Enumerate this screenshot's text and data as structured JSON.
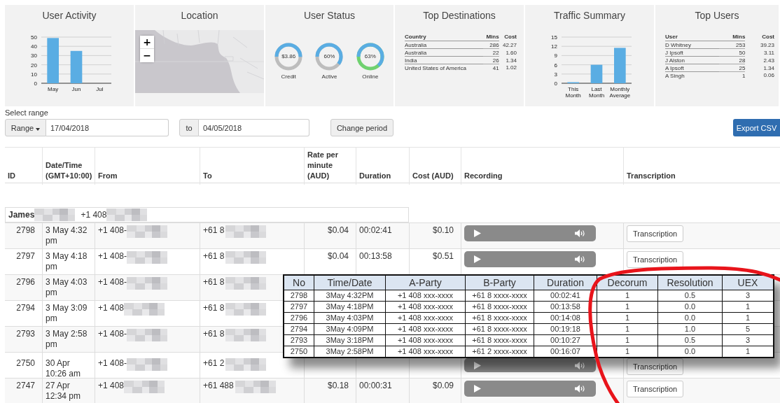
{
  "cards": [
    {
      "kind": "bar_chart",
      "title": "User Activity",
      "chart_data": {
        "type": "bar",
        "categories": [
          "May",
          "Jun",
          "Jul"
        ],
        "values": [
          49,
          35,
          0
        ],
        "grid": true,
        "ylim": [
          0,
          50
        ],
        "yticks": [
          0,
          10,
          20,
          30,
          40,
          50
        ]
      }
    },
    {
      "kind": "map",
      "title": "Location",
      "zoom_in": "+",
      "zoom_out": "−"
    },
    {
      "kind": "donuts",
      "title": "User Status",
      "donuts": [
        {
          "value": "$3.86",
          "label": "Credit",
          "level": 0.5,
          "color": "#bdbdbd"
        },
        {
          "value": "60%",
          "label": "Active",
          "level": 0.6,
          "color": "#bdbdbd"
        },
        {
          "value": "63%",
          "label": "Online",
          "level": 0.63,
          "color": "#6fd16f"
        }
      ]
    },
    {
      "kind": "table",
      "title": "Top Destinations",
      "columns": [
        "Country",
        "Mins",
        "Cost"
      ],
      "rows": [
        [
          "Australia",
          "286",
          "42.27"
        ],
        [
          "Australia",
          "22",
          "1.60"
        ],
        [
          "India",
          "26",
          "1.34"
        ],
        [
          "United States of America",
          "41",
          "1.02"
        ]
      ]
    },
    {
      "kind": "bar_chart",
      "title": "Traffic Summary",
      "chart_data": {
        "type": "bar",
        "categories": [
          "This Month",
          "Last Month",
          "Monthly Average"
        ],
        "values": [
          0.1,
          6,
          11.5
        ],
        "grid": true,
        "ylim": [
          0,
          15
        ],
        "yticks": [
          0,
          3,
          6,
          9,
          12,
          15
        ]
      }
    },
    {
      "kind": "table",
      "title": "Top Users",
      "columns": [
        "User",
        "Mins",
        "Cost"
      ],
      "rows": [
        [
          "D Whitney",
          "253",
          "39.23"
        ],
        [
          "J Ipsoft",
          "50",
          "3.11"
        ],
        [
          "J Alston",
          "28",
          "2.43"
        ],
        [
          "A Ipsoft",
          "25",
          "1.34"
        ],
        [
          "A Singh",
          "1",
          "0.06"
        ]
      ]
    }
  ],
  "range": {
    "label": "Select range",
    "dropdown": "Range",
    "from": "17/04/2018",
    "to_label": "to",
    "to": "04/05/2018",
    "change": "Change period",
    "export": "Export CSV"
  },
  "table": {
    "columns": [
      "ID",
      "Date/Time (GMT+10:00)",
      "From",
      "To",
      "Rate per minute (AUD)",
      "Duration",
      "Cost (AUD)",
      "Recording",
      "Transcription"
    ],
    "group": {
      "name": "James",
      "phone": "+1 408"
    },
    "rows": [
      {
        "id": "2798",
        "datetime": "3 May 4:32 pm",
        "from": "+1 408-",
        "to": "+61 8",
        "rate": "$0.04",
        "duration": "00:02:41",
        "cost": "$0.10",
        "player": true,
        "transcription": "Transcription"
      },
      {
        "id": "2797",
        "datetime": "3 May 4:18 pm",
        "from": "+1 408-",
        "to": "+61 8",
        "rate": "$0.04",
        "duration": "00:13:58",
        "cost": "$0.51",
        "player": true,
        "transcription": "Transcription"
      },
      {
        "id": "2796",
        "datetime": "3 May 4:03 pm",
        "from": "+1 408-",
        "to": "+61 8"
      },
      {
        "id": "2794",
        "datetime": "3 May 3:09 pm",
        "from": "+1 408",
        "to": "+61 8"
      },
      {
        "id": "2793",
        "datetime": "3 May 2:58 pm",
        "from": "+1 408-",
        "to": "+61 8"
      },
      {
        "id": "2750",
        "datetime": "30 Apr 10:26 am",
        "from": "+1 408-",
        "to": "+61 2",
        "player": true,
        "transcription": "Transcription"
      },
      {
        "id": "2747",
        "datetime": "27 Apr 12:34 pm",
        "from": "+1 408",
        "to": "+61 488",
        "rate": "$0.18",
        "duration": "00:00:31",
        "cost": "$0.09",
        "player": true,
        "transcription": "Transcription"
      }
    ]
  },
  "overlay_table": {
    "columns": [
      "No",
      "Time/Date",
      "A-Party",
      "B-Party",
      "Duration",
      "Decorum",
      "Resolution",
      "UEX"
    ],
    "rows": [
      [
        "2798",
        "3May 4:32PM",
        "+1 408 xxx-xxxx",
        "+61 8 xxxx-xxxx",
        "00:02:41",
        "1",
        "0.5",
        "3"
      ],
      [
        "2797",
        "3May 4:18PM",
        "+1 408 xxx-xxxx",
        "+61 8 xxxx-xxxx",
        "00:13:58",
        "1",
        "0.0",
        "1"
      ],
      [
        "2796",
        "3May 4:03PM",
        "+1 408 xxx-xxxx",
        "+61 8 xxxx-xxxx",
        "00:14:08",
        "1",
        "0.0",
        "1"
      ],
      [
        "2794",
        "3May 4:09PM",
        "+1 408 xxx-xxxx",
        "+61 8 xxxx-xxxx",
        "00:19:18",
        "1",
        "1.0",
        "5"
      ],
      [
        "2793",
        "3May 3:18PM",
        "+1 408 xxx-xxxx",
        "+61 8 xxxx-xxxx",
        "00:10:27",
        "1",
        "0.5",
        "3"
      ],
      [
        "2750",
        "3May 2:58PM",
        "+1 408 xxx-xxxx",
        "+61 2 xxxx-xxxx",
        "00:16:07",
        "1",
        "0.0",
        "1"
      ]
    ]
  }
}
